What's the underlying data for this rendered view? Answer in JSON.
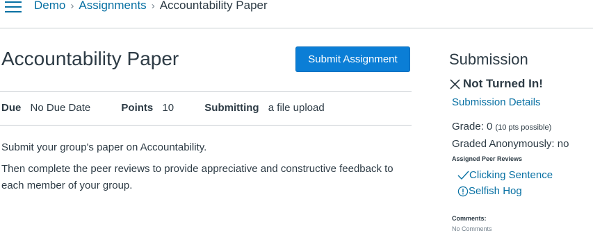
{
  "breadcrumb": {
    "items": [
      "Demo",
      "Assignments"
    ],
    "current": "Accountability Paper",
    "separator": "›"
  },
  "assignment": {
    "title": "Accountability Paper",
    "submit_label": "Submit Assignment",
    "details": [
      {
        "label": "Due",
        "value": "No Due Date"
      },
      {
        "label": "Points",
        "value": "10"
      },
      {
        "label": "Submitting",
        "value": "a file upload"
      }
    ],
    "description": [
      "Submit your group's paper on Accountability.",
      "Then complete the peer reviews to provide appreciative and constructive feedback to each member of your group."
    ]
  },
  "submission": {
    "heading": "Submission",
    "status": "Not Turned In!",
    "details_link": "Submission Details",
    "grade_label": "Grade: 0",
    "grade_possible": "(10 pts possible)",
    "graded_anonymously": "Graded Anonymously: no",
    "peer_reviews_heading": "Assigned Peer Reviews",
    "peer_reviews": [
      {
        "name": "Clicking Sentence",
        "icon": "checkmark-icon"
      },
      {
        "name": "Selfish Hog",
        "icon": "warning-circle-icon"
      }
    ],
    "comments_heading": "Comments:",
    "comments_value": "No Comments"
  },
  "colors": {
    "link": "#0770a3",
    "button": "#0b7ed6",
    "text": "#2d3b45",
    "divider": "#c7cdd1"
  }
}
